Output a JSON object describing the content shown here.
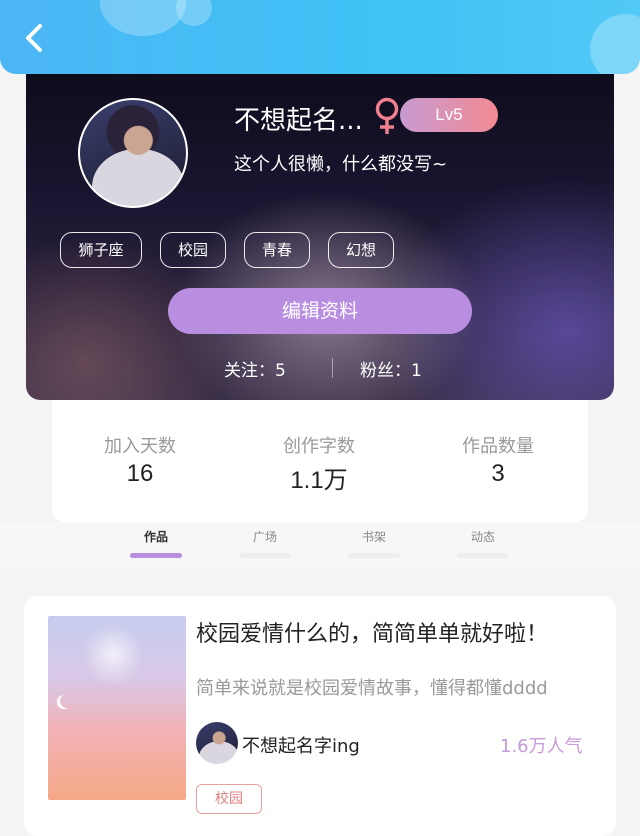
{
  "header": {
    "back_icon": "chevron-left-icon"
  },
  "profile": {
    "name": "不想起名...",
    "gender_icon": "female-icon",
    "level": "Lv5",
    "bio": "这个人很懒，什么都没写~",
    "tags": [
      "狮子座",
      "校园",
      "青春",
      "幻想"
    ],
    "edit_label": "编辑资料",
    "following": "关注：5",
    "followers": "粉丝：1"
  },
  "stats": [
    {
      "label": "加入天数",
      "value": "16"
    },
    {
      "label": "创作字数",
      "value": "1.1万"
    },
    {
      "label": "作品数量",
      "value": "3"
    }
  ],
  "tabs": [
    {
      "label": "作品",
      "active": true
    },
    {
      "label": "广场",
      "active": false
    },
    {
      "label": "书架",
      "active": false
    },
    {
      "label": "动态",
      "active": false
    }
  ],
  "work": {
    "title": "校园爱情什么的，简简单单就好啦！",
    "description": "简单来说就是校园爱情故事，懂得都懂dddd",
    "author": "不想起名字ing",
    "popularity": "1.6万人气",
    "tag": "校园"
  },
  "colors": {
    "header_blue": "#4cb6f4",
    "accent_purple": "#b98ee0",
    "gender_pink": "#ef7f8e"
  }
}
